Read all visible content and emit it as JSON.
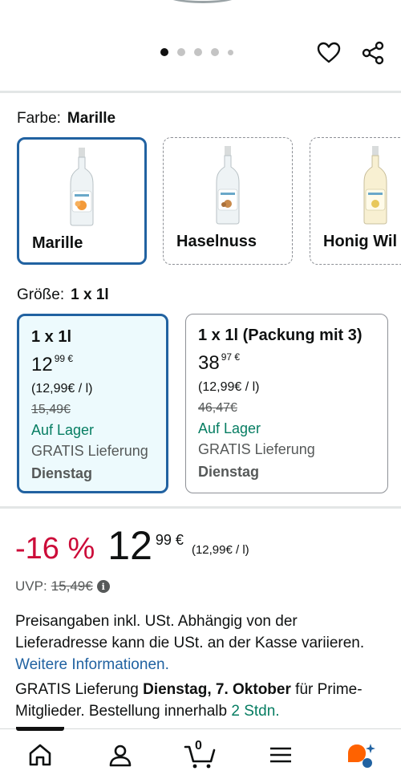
{
  "gallery": {
    "dots_count": 5,
    "active_index": 0
  },
  "color": {
    "label": "Farbe:",
    "selected": "Marille",
    "options": [
      {
        "label": "Marille",
        "accent": "#f39a3a"
      },
      {
        "label": "Haselnuss",
        "accent": "#c98a4b"
      },
      {
        "label": "Honig Wil",
        "accent": "#e8c85a"
      }
    ]
  },
  "size": {
    "label": "Größe:",
    "selected": "1 x 1l",
    "options": [
      {
        "title": "1 x 1l",
        "price_whole": "12",
        "price_fraction": "99 €",
        "unit_price": "(12,99€ / l)",
        "old_price": "15,49€",
        "stock": "Auf Lager",
        "shipping": "GRATIS Lieferung",
        "day": "Dienstag"
      },
      {
        "title": "1 x 1l (Packung mit 3)",
        "price_whole": "38",
        "price_fraction": "97 €",
        "unit_price": "(12,99€ / l)",
        "old_price": "46,47€",
        "stock": "Auf Lager",
        "shipping": "GRATIS Lieferung",
        "day": "Dienstag"
      }
    ]
  },
  "price": {
    "discount": "-16 %",
    "whole": "12",
    "fraction": "99 €",
    "unit": "(12,99€ / l)",
    "uvp_label": "UVP:",
    "uvp_value": "15,49€",
    "info_glyph": "i"
  },
  "tax": {
    "text": "Preisangaben inkl. USt. Abhängig von der Lieferadresse kann die USt. an der Kasse variieren.",
    "link": "Weitere Informationen."
  },
  "delivery": {
    "prefix": "GRATIS Lieferung",
    "date": "Dienstag, 7. Oktober",
    "middle": "für Prime-Mitglieder. Bestellung innerhalb",
    "countdown": "2 Stdn."
  },
  "nav": {
    "cart_count": "0",
    "items": [
      "home-icon",
      "account-icon",
      "cart-icon",
      "menu-icon",
      "ai-assistant-icon"
    ]
  },
  "colors": {
    "accent_blue": "#2162a1",
    "discount_red": "#cc0c39",
    "stock_green": "#067d62",
    "selected_bg": "#edfafd"
  }
}
